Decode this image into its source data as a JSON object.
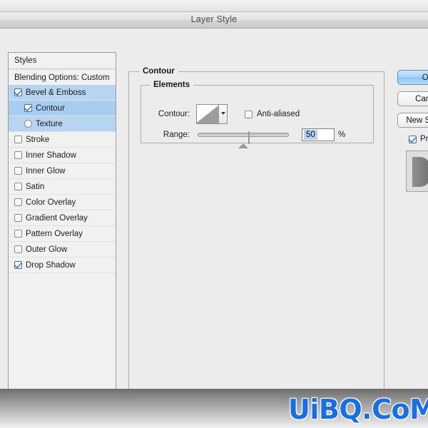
{
  "window": {
    "title": "Layer Style"
  },
  "styles_panel": {
    "header": "Styles",
    "blending_options": "Blending Options: Custom",
    "effects": [
      {
        "label": "Bevel & Emboss",
        "checked": true,
        "selected": true,
        "sub": false,
        "round": false
      },
      {
        "label": "Contour",
        "checked": true,
        "selected": true,
        "sub": true,
        "round": false
      },
      {
        "label": "Texture",
        "checked": false,
        "selected": true,
        "sub": true,
        "round": true
      },
      {
        "label": "Stroke",
        "checked": false,
        "selected": false,
        "sub": false,
        "round": false
      },
      {
        "label": "Inner Shadow",
        "checked": false,
        "selected": false,
        "sub": false,
        "round": false
      },
      {
        "label": "Inner Glow",
        "checked": false,
        "selected": false,
        "sub": false,
        "round": false
      },
      {
        "label": "Satin",
        "checked": false,
        "selected": false,
        "sub": false,
        "round": false
      },
      {
        "label": "Color Overlay",
        "checked": false,
        "selected": false,
        "sub": false,
        "round": false
      },
      {
        "label": "Gradient Overlay",
        "checked": false,
        "selected": false,
        "sub": false,
        "round": false
      },
      {
        "label": "Pattern Overlay",
        "checked": false,
        "selected": false,
        "sub": false,
        "round": false
      },
      {
        "label": "Outer Glow",
        "checked": false,
        "selected": false,
        "sub": false,
        "round": false
      },
      {
        "label": "Drop Shadow",
        "checked": true,
        "selected": false,
        "sub": false,
        "round": false
      }
    ]
  },
  "contour_panel": {
    "group_title": "Contour",
    "elements_title": "Elements",
    "contour_label": "Contour:",
    "contour_swatch_name": "linear-contour-ramp",
    "anti_aliased_label": "Anti-aliased",
    "anti_aliased_checked": false,
    "range_label": "Range:",
    "range_value": "50",
    "range_unit": "%",
    "range_percent": 50
  },
  "buttons": {
    "ok": "OK",
    "cancel": "Cancel",
    "new_style": "New Style...",
    "preview_label": "Preview",
    "preview_checked": true
  },
  "watermark": {
    "text": "UiBQ.CoM",
    "color": "#1a6fe0"
  }
}
